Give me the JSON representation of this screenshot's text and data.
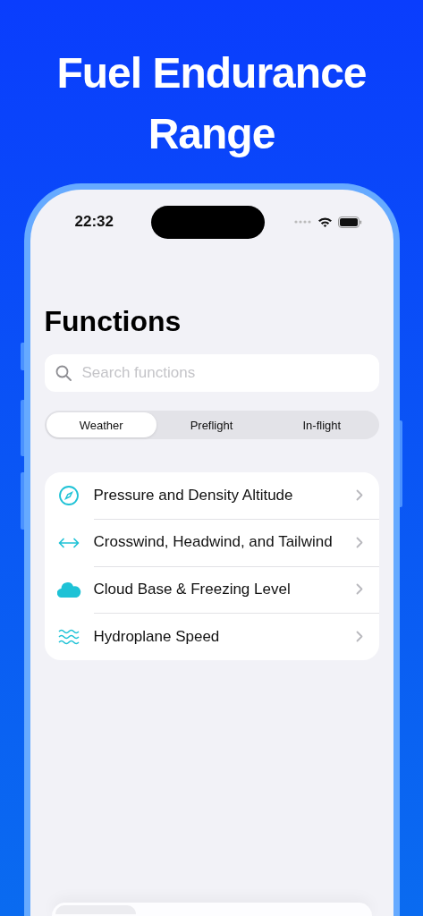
{
  "headline": "Fuel Endurance Range",
  "status_bar": {
    "time": "22:32"
  },
  "title": "Functions",
  "search": {
    "placeholder": "Search functions"
  },
  "tabs": [
    {
      "label": "Weather",
      "selected": true
    },
    {
      "label": "Preflight",
      "selected": false
    },
    {
      "label": "In-flight",
      "selected": false
    }
  ],
  "items": [
    {
      "label": "Pressure and Density Altitude",
      "kind": "compass"
    },
    {
      "label": "Crosswind, Headwind, and Tailwind",
      "kind": "arrows"
    },
    {
      "label": "Cloud Base & Freezing Level",
      "kind": "cloud"
    },
    {
      "label": "Hydroplane Speed",
      "kind": "waves"
    }
  ]
}
